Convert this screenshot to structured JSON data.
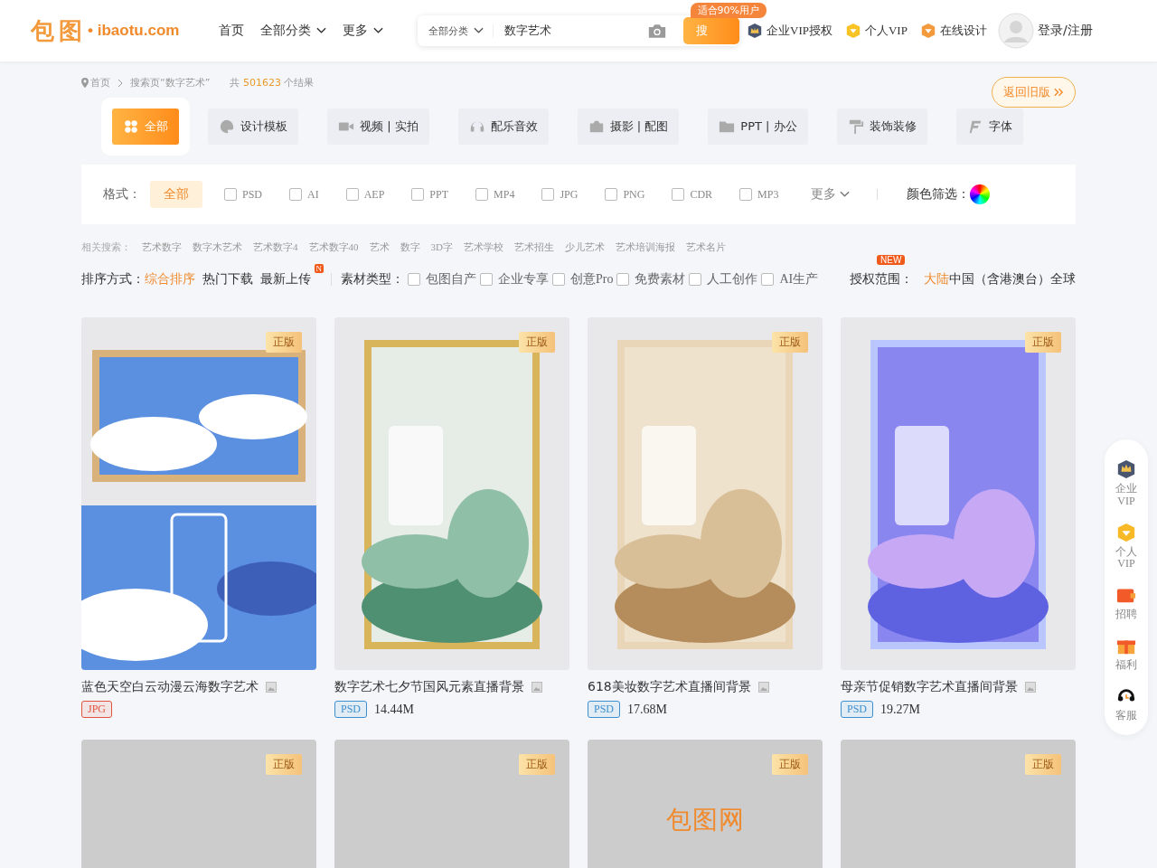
{
  "header": {
    "logo_mark": "包 图",
    "logo_text": "• ibaotu.com",
    "nav": [
      "首页",
      "全部分类",
      "更多"
    ],
    "search": {
      "category": "全部分类",
      "value": "数字艺术",
      "button": "搜",
      "promo_badge": "适合90%用户"
    },
    "links": [
      "企业VIP授权",
      "个人VIP",
      "在线设计"
    ],
    "login": "登录/注册"
  },
  "breadcrumb": {
    "home": "首页",
    "current": "搜索页“数字艺术”",
    "total_prefix": "共",
    "total": "501623",
    "total_suffix": "个结果"
  },
  "old_version_button": "返回旧版",
  "tabs": [
    {
      "label": "全部",
      "selected": true
    },
    {
      "label": "设计模板",
      "selected": false
    },
    {
      "label": "视频 | 实拍",
      "selected": false
    },
    {
      "label": "配乐音效",
      "selected": false
    },
    {
      "label": "摄影 | 配图",
      "selected": false
    },
    {
      "label": "PPT | 办公",
      "selected": false
    },
    {
      "label": "装饰装修",
      "selected": false
    },
    {
      "label": "字体",
      "selected": false
    }
  ],
  "formats": {
    "label": "格式：",
    "all": {
      "label": "全部",
      "selected": true
    },
    "options": [
      {
        "label": "PSD",
        "checked": false
      },
      {
        "label": "AI",
        "checked": false
      },
      {
        "label": "AEP",
        "checked": false
      },
      {
        "label": "PPT",
        "checked": false
      },
      {
        "label": "MP4",
        "checked": false
      },
      {
        "label": "JPG",
        "checked": false
      },
      {
        "label": "PNG",
        "checked": false
      },
      {
        "label": "CDR",
        "checked": false
      },
      {
        "label": "MP3",
        "checked": false
      }
    ],
    "more": "更多",
    "color_filter": "颜色筛选："
  },
  "related": {
    "label": "相关搜索：",
    "terms": [
      "艺术数字",
      "数字木艺术",
      "艺术数字4",
      "艺术数字40",
      "艺术",
      "数字",
      "3D字",
      "艺术学校",
      "艺术招生",
      "少儿艺术",
      "艺术培训海报",
      "艺术名片"
    ]
  },
  "sort": {
    "label": "排序方式：",
    "options": [
      {
        "label": "综合排序",
        "selected": true
      },
      {
        "label": "热门下载",
        "selected": false
      },
      {
        "label": "最新上传",
        "selected": false,
        "badge": "N"
      }
    ]
  },
  "material": {
    "label": "素材类型：",
    "options": [
      {
        "label": "包图自产",
        "checked": false
      },
      {
        "label": "企业专享",
        "checked": false
      },
      {
        "label": "创意Pro",
        "checked": false
      },
      {
        "label": "免费素材",
        "checked": false
      },
      {
        "label": "人工创作",
        "checked": false
      },
      {
        "label": "AI生产",
        "checked": false
      }
    ]
  },
  "license": {
    "label": "授权范围：",
    "badge": "NEW",
    "options": [
      {
        "label": "大陆",
        "selected": true
      },
      {
        "label": "中国（含港澳台）",
        "selected": false
      },
      {
        "label": "全球",
        "selected": false
      }
    ]
  },
  "cards": [
    {
      "badge": "正版",
      "kind": "picture",
      "title": "蓝色天空白云动漫云海数字艺术",
      "format": "JPG",
      "color": "#e0533c"
    },
    {
      "badge": "正版",
      "kind": "picture",
      "title": "数字艺术七夕节国风元素直播背景",
      "format": "PSD",
      "color": "#3d8fd0",
      "size": "14.44M"
    },
    {
      "badge": "正版",
      "kind": "picture",
      "title": "618美妆数字艺术直播间背景",
      "format": "PSD",
      "color": "#3d8fd0",
      "size": "17.68M"
    },
    {
      "badge": "正版",
      "kind": "picture",
      "title": "母亲节促销数字艺术直播间背景",
      "format": "PSD",
      "color": "#3d8fd0",
      "size": "19.27M"
    }
  ],
  "loading_cards": [
    {
      "badge": "正版"
    },
    {
      "badge": "正版"
    },
    {
      "badge": "正版",
      "logo": "包图网"
    },
    {
      "badge": "正版"
    }
  ],
  "sidebar": [
    "企业VIP",
    "个人VIP",
    "招聘",
    "福利",
    "客服"
  ]
}
